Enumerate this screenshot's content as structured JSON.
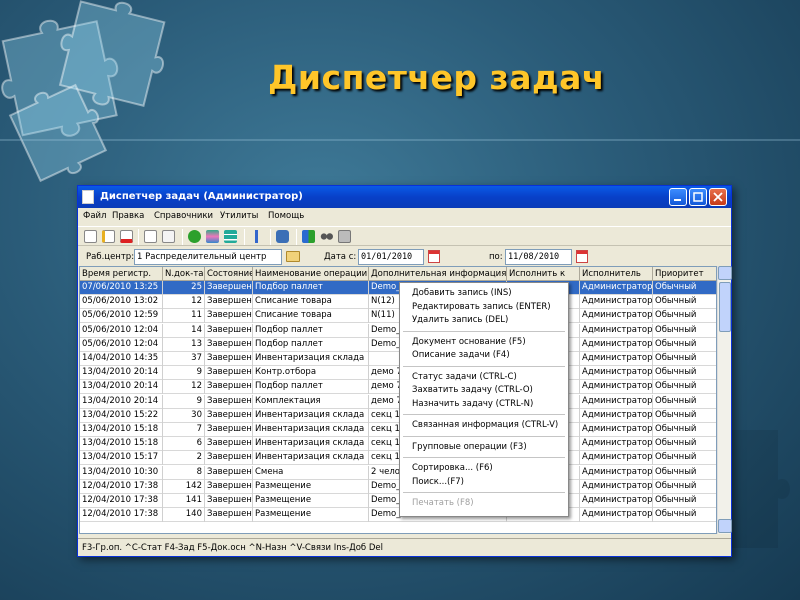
{
  "slide": {
    "title": "Диспетчер задач"
  },
  "window": {
    "title": "Диспетчер задач (Администратор)",
    "menu": [
      "Файл",
      "Правка",
      "Справочники",
      "Утилиты",
      "Помощь"
    ],
    "toolbar_icons": [
      "new-doc-icon",
      "edit-doc-icon",
      "delete-doc-icon",
      "copy-icon",
      "paste-icon",
      "check-icon",
      "refresh-icon",
      "stack-icon",
      "tree-icon",
      "save-icon",
      "filter-icon",
      "glasses-icon",
      "print-icon"
    ],
    "filter": {
      "workcenter_label": "Раб.центр:",
      "workcenter_value": "1 Распределительный центр",
      "date_from_label": "Дата с:",
      "date_from_value": "01/01/2010",
      "date_to_label": "по:",
      "date_to_value": "11/08/2010"
    },
    "columns": [
      "Время регистр.",
      "N.док-та",
      "Состояние",
      "Наименование операции",
      "Дополнительная информация",
      "Исполнить к",
      "Исполнитель",
      "Приоритет"
    ],
    "rows": [
      [
        "07/06/2010 13:25",
        "25",
        "Завершен",
        "Подбор паллет",
        "Demo_",
        "",
        "Администратор",
        "Обычный"
      ],
      [
        "05/06/2010 13:02",
        "12",
        "Завершен",
        "Списание товара",
        "N(12)",
        "",
        "Администратор",
        "Обычный"
      ],
      [
        "05/06/2010 12:59",
        "11",
        "Завершен",
        "Списание товара",
        "N(11)",
        "",
        "Администратор",
        "Обычный"
      ],
      [
        "05/06/2010 12:04",
        "14",
        "Завершен",
        "Подбор паллет",
        "Demo_",
        "",
        "Администратор",
        "Обычный"
      ],
      [
        "05/06/2010 12:04",
        "13",
        "Завершен",
        "Подбор паллет",
        "Demo_",
        "",
        "Администратор",
        "Обычный"
      ],
      [
        "14/04/2010 14:35",
        "37",
        "Завершен",
        "Инвентаризация склада",
        "",
        "",
        "Администратор",
        "Обычный"
      ],
      [
        "13/04/2010 20:14",
        "9",
        "Завершен",
        "Контр.отбора",
        "демо 7",
        "",
        "Администратор",
        "Обычный"
      ],
      [
        "13/04/2010 20:14",
        "12",
        "Завершен",
        "Подбор паллет",
        "демо 7",
        "",
        "Администратор",
        "Обычный"
      ],
      [
        "13/04/2010 20:14",
        "9",
        "Завершен",
        "Комплектация",
        "демо 7",
        "",
        "Администратор",
        "Обычный"
      ],
      [
        "13/04/2010 15:22",
        "30",
        "Завершен",
        "Инвентаризация склада",
        "секц 1",
        "",
        "Администратор",
        "Обычный"
      ],
      [
        "13/04/2010 15:18",
        "7",
        "Завершен",
        "Инвентаризация склада",
        "секц 1",
        "",
        "Администратор",
        "Обычный"
      ],
      [
        "13/04/2010 15:18",
        "6",
        "Завершен",
        "Инвентаризация склада",
        "секц 1",
        "",
        "Администратор",
        "Обычный"
      ],
      [
        "13/04/2010 15:17",
        "2",
        "Завершен",
        "Инвентаризация склада",
        "секц 1",
        "",
        "Администратор",
        "Обычный"
      ],
      [
        "13/04/2010 10:30",
        "8",
        "Завершен",
        "Смена",
        "2 чело",
        "",
        "Администратор",
        "Обычный"
      ],
      [
        "12/04/2010 17:38",
        "142",
        "Завершен",
        "Размещение",
        "Demo_",
        "",
        "Администратор",
        "Обычный"
      ],
      [
        "12/04/2010 17:38",
        "141",
        "Завершен",
        "Размещение",
        "Demo_",
        "",
        "Администратор",
        "Обычный"
      ],
      [
        "12/04/2010 17:38",
        "140",
        "Завершен",
        "Размещение",
        "Demo_",
        "",
        "Администратор",
        "Обычный"
      ]
    ],
    "status_text": "F3-Гр.оп. ^C-Стат F4-Зад F5-Док.осн ^N-Назн ^V-Связи Ins-Доб Del"
  },
  "context_menu": {
    "items": [
      {
        "label": "Добавить запись (INS)",
        "disabled": false
      },
      {
        "label": "Редактировать запись (ENTER)",
        "disabled": false
      },
      {
        "label": "Удалить запись (DEL)",
        "disabled": false
      },
      {
        "label": "Документ основание (F5)",
        "disabled": false
      },
      {
        "label": "Описание задачи (F4)",
        "disabled": false
      },
      {
        "label": "Статус задачи (CTRL-C)",
        "disabled": false
      },
      {
        "label": "Захватить задачу (CTRL-O)",
        "disabled": false
      },
      {
        "label": "Назначить задачу (CTRL-N)",
        "disabled": false
      },
      {
        "label": "Связанная информация (CTRL-V)",
        "disabled": false
      },
      {
        "label": "Групповые операции (F3)",
        "disabled": false
      },
      {
        "label": "Сортировка... (F6)",
        "disabled": false
      },
      {
        "label": "Поиск...(F7)",
        "disabled": false
      },
      {
        "label": "Печатать (F8)",
        "disabled": true
      }
    ]
  },
  "colors": {
    "title": "#ffc629",
    "selection": "#316ac5",
    "titlebar": "#0840c8"
  }
}
